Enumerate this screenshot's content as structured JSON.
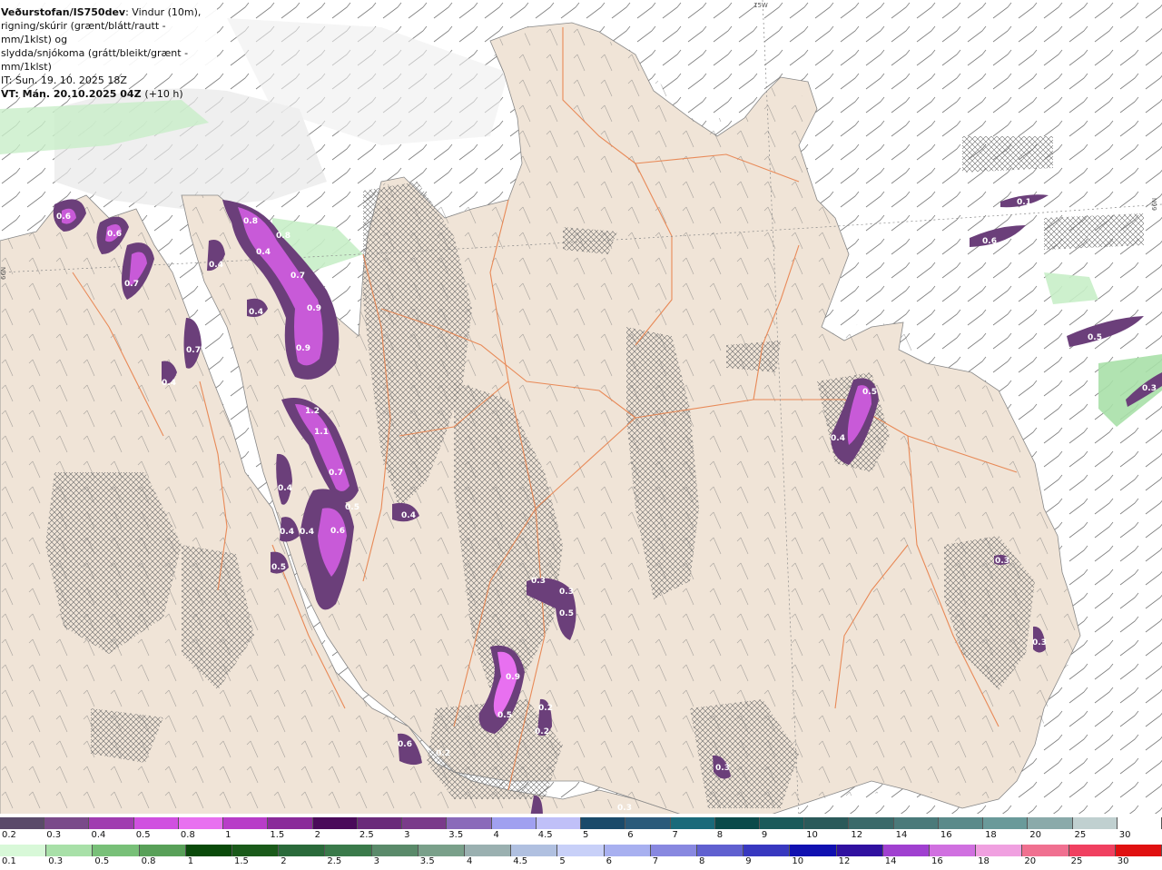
{
  "header": {
    "product": "Veðurstofan/IS750dev",
    "desc_1": ": Vindur (10m),",
    "desc_2": "rigning/skúrir (grænt/blátt/rautt - mm/1klst) og",
    "desc_3": "slydda/snjókoma (grátt/bleikt/grænt - mm/1klst)",
    "init_time": "IT: Sun. 19. 10. 2025 18Z",
    "valid_time": "VT: Mán. 20.10.2025 04Z",
    "lead": "(+10 h)"
  },
  "graticule": {
    "lon_label": "15W",
    "lat_label_left": "66N",
    "lat_label_right": "66N"
  },
  "colors": {
    "land": "#f0e4d7",
    "sea": "#ffffff",
    "roads": "#e8804a",
    "snow_light": "#d9d9d9",
    "snow_purple": "#6b3f7a",
    "snow_magenta": "#c85ad8",
    "rain_green": "#c8eec8"
  },
  "precip_labels": [
    {
      "v": "0.6"
    },
    {
      "v": "0.6"
    },
    {
      "v": "0.7"
    },
    {
      "v": "0.8"
    },
    {
      "v": "0.8"
    },
    {
      "v": "0.4"
    },
    {
      "v": "0.4"
    },
    {
      "v": "0.4"
    },
    {
      "v": "0.7"
    },
    {
      "v": "0.9"
    },
    {
      "v": "0.9"
    },
    {
      "v": "0.7"
    },
    {
      "v": "0.4"
    },
    {
      "v": "1.2"
    },
    {
      "v": "1.1"
    },
    {
      "v": "0.7"
    },
    {
      "v": "0.5"
    },
    {
      "v": "0.4"
    },
    {
      "v": "0.4"
    },
    {
      "v": "0.4"
    },
    {
      "v": "0.6"
    },
    {
      "v": "0.4"
    },
    {
      "v": "0.5"
    },
    {
      "v": "0.3"
    },
    {
      "v": "0.3"
    },
    {
      "v": "0.5"
    },
    {
      "v": "0.9"
    },
    {
      "v": "0.5"
    },
    {
      "v": "0.2"
    },
    {
      "v": "0.2"
    },
    {
      "v": "0.6"
    },
    {
      "v": "0.2"
    },
    {
      "v": "0.3"
    },
    {
      "v": "0.3"
    },
    {
      "v": "0.5"
    },
    {
      "v": "0.4"
    },
    {
      "v": "0.1"
    },
    {
      "v": "0.6"
    },
    {
      "v": "0.5"
    },
    {
      "v": "0.3"
    },
    {
      "v": "0.3"
    },
    {
      "v": "0.3"
    }
  ],
  "legend_snow": {
    "labels": [
      "0.2",
      "0.3",
      "0.4",
      "0.5",
      "0.8",
      "1",
      "1.5",
      "2",
      "2.5",
      "3",
      "3.5",
      "4",
      "4.5",
      "5",
      "6",
      "7",
      "8",
      "9",
      "10",
      "12",
      "14",
      "16",
      "18",
      "20",
      "25",
      "30"
    ],
    "colors": [
      "#5a4a6a",
      "#7a4a8a",
      "#a03cb0",
      "#d050e0",
      "#e870f0",
      "#b83cc8",
      "#8a2a9a",
      "#4a0a5a",
      "#6a2a7a",
      "#7a3a8a",
      "#8a6aba",
      "#a0a0f0",
      "#c0c0f8",
      "#1a4a6a",
      "#2a5a7a",
      "#1a6a7a",
      "#0a4a4a",
      "#1a5a5a",
      "#2a5a5a",
      "#3a6a6a",
      "#4a7a7a",
      "#5a8a8a",
      "#6a9a9a",
      "#8aaaaa",
      "#c0d0d0",
      "#ffffff"
    ]
  },
  "legend_rain": {
    "labels": [
      "0.1",
      "0.3",
      "0.5",
      "0.8",
      "1",
      "1.5",
      "2",
      "2.5",
      "3",
      "3.5",
      "4",
      "4.5",
      "5",
      "6",
      "7",
      "8",
      "9",
      "10",
      "12",
      "14",
      "16",
      "18",
      "20",
      "25",
      "30"
    ],
    "colors": [
      "#d8f8d8",
      "#a8e0a8",
      "#78c078",
      "#58a058",
      "#0a4a0a",
      "#1a5a1a",
      "#2a6a3a",
      "#3a7a4a",
      "#5a8a6a",
      "#7aa08a",
      "#9ab0b0",
      "#b0c0e0",
      "#c8d0f8",
      "#a8b0f0",
      "#8888e0",
      "#6060d0",
      "#3838c0",
      "#1010b0",
      "#3010a0",
      "#a040d0",
      "#d070e0",
      "#f0a0e0",
      "#f07090",
      "#f04060",
      "#e01010"
    ]
  }
}
